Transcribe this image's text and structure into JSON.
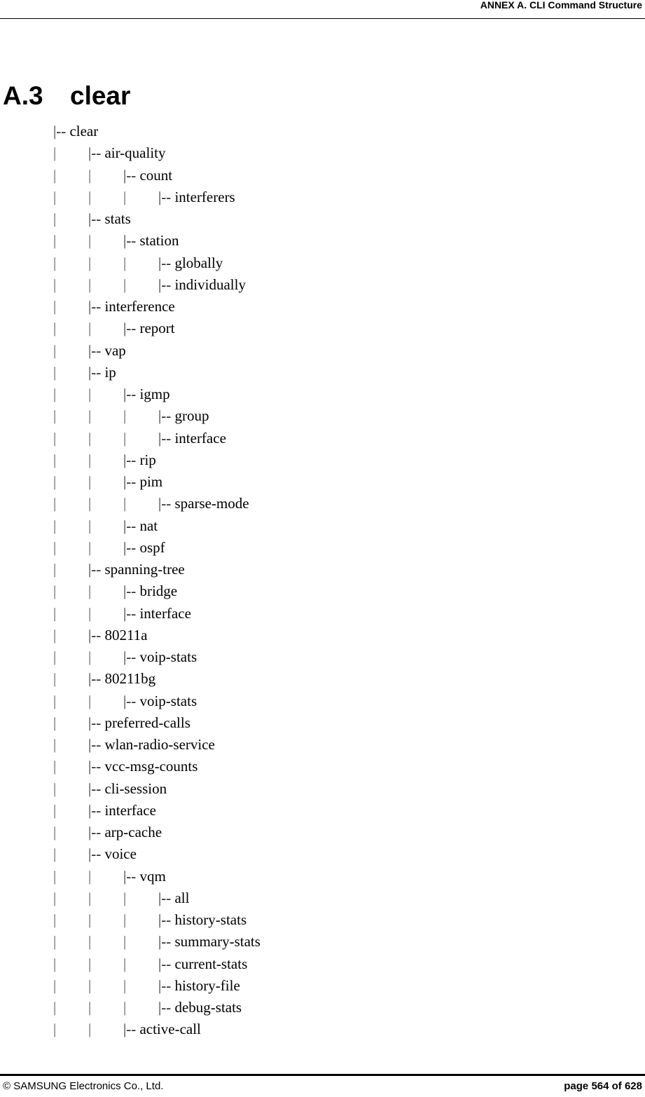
{
  "header": {
    "title": "ANNEX A. CLI Command Structure"
  },
  "section": {
    "number": "A.3",
    "title": "clear"
  },
  "tree": [
    {
      "depth": 0,
      "label": "clear"
    },
    {
      "depth": 1,
      "label": "air-quality"
    },
    {
      "depth": 2,
      "label": "count"
    },
    {
      "depth": 3,
      "label": "interferers"
    },
    {
      "depth": 1,
      "label": "stats"
    },
    {
      "depth": 2,
      "label": "station"
    },
    {
      "depth": 3,
      "label": "globally"
    },
    {
      "depth": 3,
      "label": "individually"
    },
    {
      "depth": 1,
      "label": "interference"
    },
    {
      "depth": 2,
      "label": "report"
    },
    {
      "depth": 1,
      "label": "vap"
    },
    {
      "depth": 1,
      "label": "ip"
    },
    {
      "depth": 2,
      "label": "igmp"
    },
    {
      "depth": 3,
      "label": "group"
    },
    {
      "depth": 3,
      "label": "interface"
    },
    {
      "depth": 2,
      "label": "rip"
    },
    {
      "depth": 2,
      "label": "pim"
    },
    {
      "depth": 3,
      "label": "sparse-mode"
    },
    {
      "depth": 2,
      "label": "nat"
    },
    {
      "depth": 2,
      "label": "ospf"
    },
    {
      "depth": 1,
      "label": "spanning-tree"
    },
    {
      "depth": 2,
      "label": "bridge"
    },
    {
      "depth": 2,
      "label": "interface"
    },
    {
      "depth": 1,
      "label": "80211a"
    },
    {
      "depth": 2,
      "label": "voip-stats"
    },
    {
      "depth": 1,
      "label": "80211bg"
    },
    {
      "depth": 2,
      "label": "voip-stats"
    },
    {
      "depth": 1,
      "label": "preferred-calls"
    },
    {
      "depth": 1,
      "label": "wlan-radio-service"
    },
    {
      "depth": 1,
      "label": "vcc-msg-counts"
    },
    {
      "depth": 1,
      "label": "cli-session"
    },
    {
      "depth": 1,
      "label": "interface"
    },
    {
      "depth": 1,
      "label": "arp-cache"
    },
    {
      "depth": 1,
      "label": "voice"
    },
    {
      "depth": 2,
      "label": "vqm"
    },
    {
      "depth": 3,
      "label": "all"
    },
    {
      "depth": 3,
      "label": "history-stats"
    },
    {
      "depth": 3,
      "label": "summary-stats"
    },
    {
      "depth": 3,
      "label": "current-stats"
    },
    {
      "depth": 3,
      "label": "history-file"
    },
    {
      "depth": 3,
      "label": "debug-stats"
    },
    {
      "depth": 2,
      "label": "active-call"
    }
  ],
  "tree_branch_prefix": "|-- ",
  "tree_pipe": "|",
  "footer": {
    "copyright": "© SAMSUNG Electronics Co., Ltd.",
    "page": "page 564 of 628"
  }
}
